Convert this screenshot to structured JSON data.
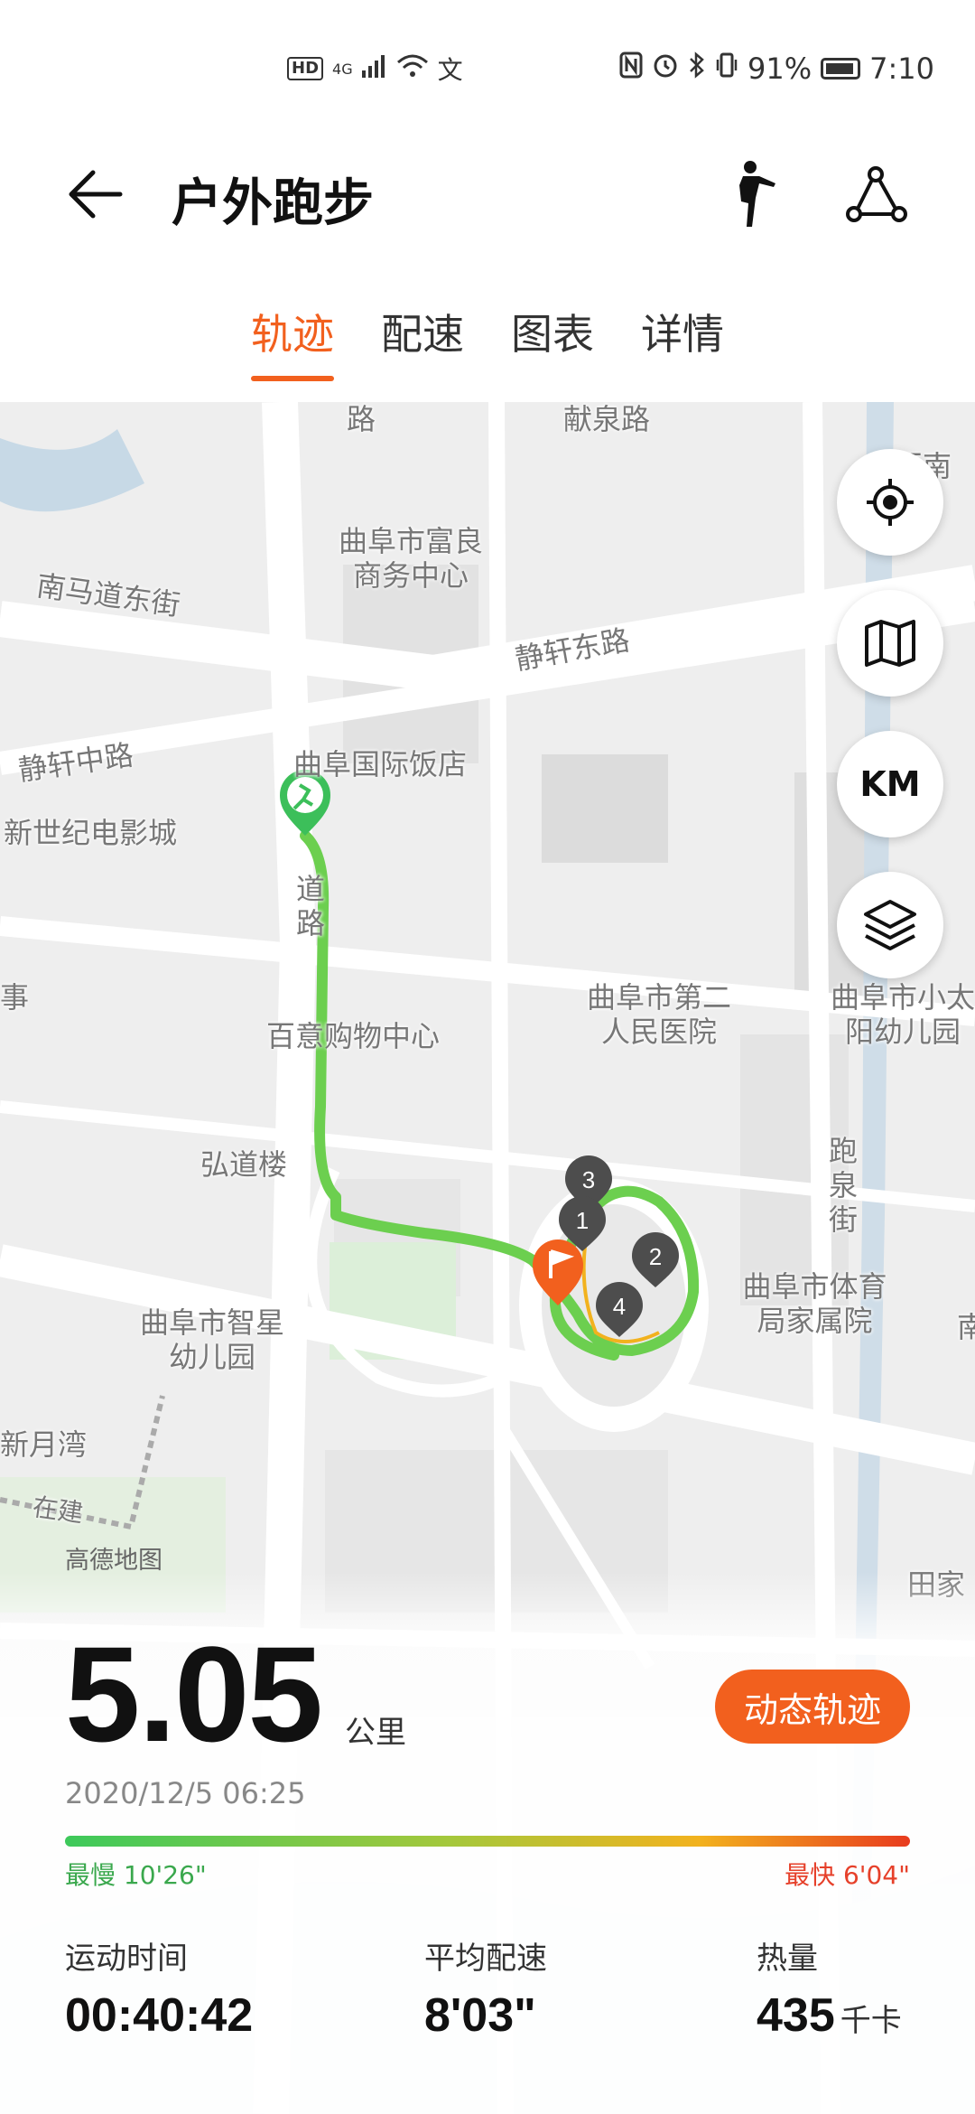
{
  "status_bar": {
    "left": {
      "hd": "HD",
      "network": "4G",
      "wifi_icon": "wifi-icon",
      "text_icon": "文"
    },
    "right": {
      "battery_percent": "91%",
      "time": "7:10"
    }
  },
  "header": {
    "title": "户外跑步"
  },
  "tabs": [
    {
      "label": "轨迹",
      "active": true
    },
    {
      "label": "配速",
      "active": false
    },
    {
      "label": "图表",
      "active": false
    },
    {
      "label": "详情",
      "active": false
    }
  ],
  "map": {
    "labels": {
      "road_top": "路",
      "xianquan_road": "献泉路",
      "qufu_fuliang": "曲阜市富良商务中心",
      "nanmadao": "南马道东街",
      "jingxuan_east": "静轩东路",
      "jingxuan_mid": "静轩中路",
      "hotel": "曲阜国际饭店",
      "cinema": "新世纪电影城",
      "dao_road": "道路",
      "shi": "事",
      "baiyi": "百意购物中心",
      "hospital2": "曲阜市第二人民医院",
      "kindergarten_right": "曲阜市小太阳幼儿园",
      "paoquan": "跑泉街",
      "hongdao": "弘道楼",
      "sports_bureau": "曲阜市体育局家属院",
      "zhixing": "曲阜市智星幼儿园",
      "xinyuewan": "新月湾",
      "zaijian": "在建",
      "tianjia": "田家",
      "nan": "南",
      "quter": "区南"
    },
    "attribution": "高德地图",
    "km_button": "KM",
    "markers": [
      "1",
      "2",
      "3",
      "4"
    ]
  },
  "summary": {
    "distance": "5.05",
    "distance_unit": "公里",
    "dynamic_button": "动态轨迹",
    "date": "2020/12/5 06:25",
    "slowest": "最慢 10'26\"",
    "fastest": "最快 6'04\"",
    "stats": [
      {
        "label": "运动时间",
        "value": "00:40:42",
        "unit": ""
      },
      {
        "label": "平均配速",
        "value": "8'03\"",
        "unit": ""
      },
      {
        "label": "热量",
        "value": "435",
        "unit": "千卡"
      }
    ]
  }
}
